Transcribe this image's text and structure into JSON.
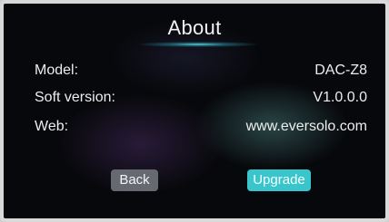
{
  "page": {
    "title": "About"
  },
  "info": {
    "model": {
      "label": "Model:",
      "value": "DAC-Z8"
    },
    "soft_version": {
      "label": "Soft version:",
      "value": "V1.0.0.0"
    },
    "web": {
      "label": "Web:",
      "value": "www.eversolo.com"
    }
  },
  "buttons": {
    "back": "Back",
    "upgrade": "Upgrade"
  },
  "colors": {
    "accent": "#38c6cc",
    "button_secondary": "#666a70",
    "background": "#07080b"
  }
}
